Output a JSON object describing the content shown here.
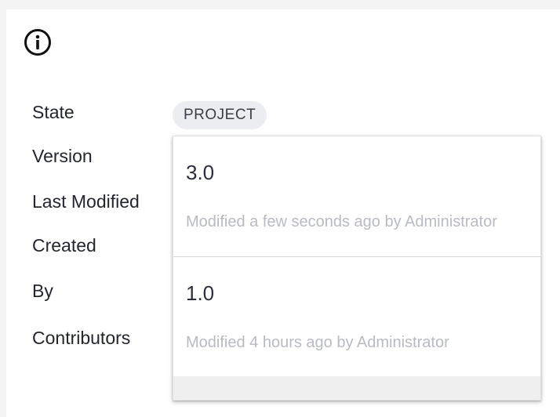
{
  "icons": {
    "info": "info-icon"
  },
  "properties": {
    "state_label": "State",
    "version_label": "Version",
    "last_modified_label": "Last Modified",
    "created_label": "Created",
    "by_label": "By",
    "contributors_label": "Contributors"
  },
  "state_badge": "PROJECT",
  "version_dropdown": {
    "options": [
      {
        "version": "3.0",
        "description": "Modified a few seconds ago by Administrator"
      },
      {
        "version": "1.0",
        "description": "Modified 4 hours ago by Administrator"
      }
    ]
  },
  "colors": {
    "text": "#24262e",
    "muted": "#b9bbc2",
    "chip_bg": "#ecedf0"
  }
}
